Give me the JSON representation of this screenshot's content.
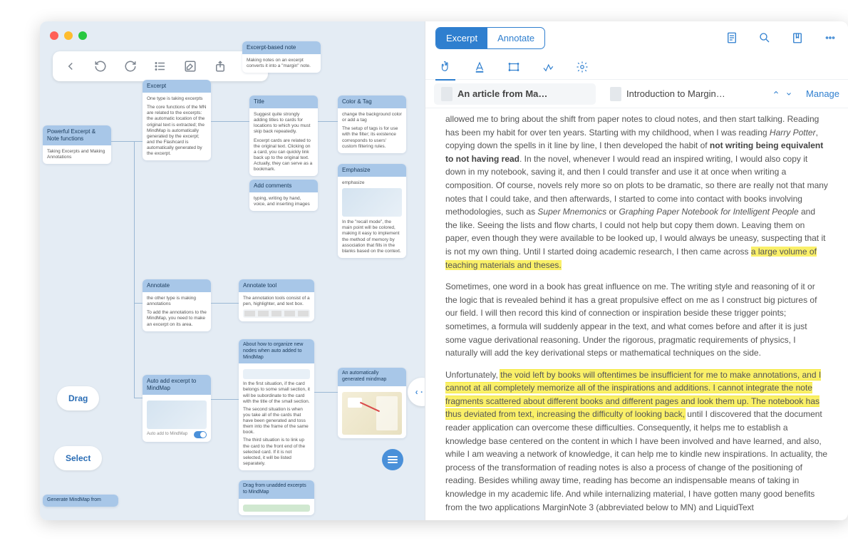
{
  "toolbar": {
    "back": "back-icon",
    "undo": "undo-icon",
    "redo": "redo-icon",
    "list": "list-icon",
    "edit": "edit-icon",
    "share": "share-icon",
    "more": "more-icon"
  },
  "reader": {
    "seg_excerpt": "Excerpt",
    "seg_annotate": "Annotate",
    "tab1": "An article from Ma…",
    "tab2": "Introduction to Margin…",
    "manage": "Manage"
  },
  "badges": {
    "drag": "Drag",
    "select": "Select"
  },
  "nodes": {
    "root": {
      "title": "Powerful Excerpt & Note functions",
      "body": "Taking Excerpts and Making Annotations"
    },
    "excerpt": {
      "title": "Excerpt",
      "body1": "One type is taking excerpts",
      "body2": "The core functions of the MN are related to the excerpts: the automatic location of the original text is extracted; the MindMap is automatically generated by the excerpt; and the Flashcard is automatically generated by the excerpt."
    },
    "ebn": {
      "title": "Excerpt-based note",
      "body": "Making notes on an excerpt converts it into a \"margin\" note."
    },
    "title": {
      "title": "Title",
      "body1": "Suggest quite strongly adding titles to cards for locations to which you must skip back repeatedly.",
      "body2": "Excerpt cards are related to the original text. Clicking on a card, you can quickly link back up to the original text. Actually, they can serve as a bookmark."
    },
    "color": {
      "title": "Color & Tag",
      "body1": "change the background color or add a tag",
      "body2": "The setup of tags is for use with the filter; its existence corresponds to users' custom filtering rules."
    },
    "emphasize": {
      "title": "Emphasize",
      "body1": "emphasize",
      "body2": "In the \"recall mode\", the main point will be colored, making it easy to implement the method of memory by association that fills in the blanks based on the context."
    },
    "addc": {
      "title": "Add comments",
      "body": "typing, writing by hand, voice, and inserting images"
    },
    "annotate": {
      "title": "Annotate",
      "body1": "the other type is making annotations",
      "body2": "To add the annotations to the MindMap, you need to make an excerpt on its area."
    },
    "atool": {
      "title": "Annotate tool",
      "body": "The annotation tools consist of a pen, highlighter, and text box."
    },
    "organize": {
      "title": "About how to organize new nodes when auto added to MindMap",
      "body1": "In the first situation, if the card belongs to some small section, it will be subordinate to the card with the title of the small section.",
      "body2": "The second situation is when you take all of the cards that have been generated and toss them into the frame of the same book.",
      "body3": "The third situation is to link up the card to the front end of the selected card. If it is not selected, it will be listed separately."
    },
    "autoadd": {
      "title": "Auto add excerpt to MindMap"
    },
    "autogen": {
      "title": "An automatically generated mindmap"
    },
    "dragun": {
      "title": "Drag from unadded excerpts to MindMap"
    },
    "genfrom": {
      "title": "Generate MindMap from"
    }
  },
  "article": {
    "p1a": "allowed me to bring about the shift from paper notes to cloud notes, and then start talking. Reading has been my habit for over ten years. Starting with my childhood, when I was reading ",
    "p1i1": "Harry Potter",
    "p1b": ", copying down the spells in it line by line, I then developed the habit of ",
    "p1bold": "not writing being equivalent to not having read",
    "p1c": ". In the novel, whenever I would read an inspired writing, I would also copy it down in my notebook, saving it, and then I could transfer and use it at once when writing a composition. Of course, novels rely more so on plots to be dramatic, so there are really not that many notes that I could take, and then afterwards, I started to come into contact with books involving methodologies, such as ",
    "p1i2": "Super Mnemonics",
    "p1d": " or ",
    "p1i3": "Graphing Paper Notebook for Intelligent People",
    "p1e": " and the like. Seeing the lists and flow charts, I could not help but copy them down. Leaving them on paper, even though they were available to be looked up, I would always be uneasy, suspecting that it is not my own thing. Until I started doing academic research, I then came across ",
    "p1hl": "a large volume of teaching materials and theses.",
    "p2": "Sometimes, one word in a book has great influence on me. The writing style and reasoning of it or the logic that is revealed behind it has a great propulsive effect on me as I construct big pictures of our field. I will then record this kind of connection or inspiration beside these trigger points; sometimes, a formula will suddenly appear in the text, and what comes before and after it is just some vague derivational reasoning. Under the rigorous, pragmatic requirements of physics, I naturally will add the key derivational steps or mathematical techniques on the side.",
    "p3a": "Unfortunately, ",
    "p3hl": "the void left by books will oftentimes be insufficient for me to make annotations, and I cannot at all completely memorize all of the inspirations and additions. I cannot integrate the note fragments scattered about different books and different pages and look them up. The notebook has thus deviated from text, increasing the difficulty of looking back,",
    "p3b": " until I discovered that the document reader application can overcome these difficulties. Consequently, it helps me to establish a knowledge base centered on the content in which I have been involved and have learned, and also, while I am weaving a network of knowledge, it can help me to kindle new inspirations. In actuality, the process of the transformation of reading notes is also a process of change of the positioning of reading. Besides whiling away time, reading has become an indispensable means of taking in knowledge in my academic life. And while internalizing material, I have gotten many good benefits from the two applications MarginNote 3 (abbreviated below to MN) and LiquidText"
  }
}
